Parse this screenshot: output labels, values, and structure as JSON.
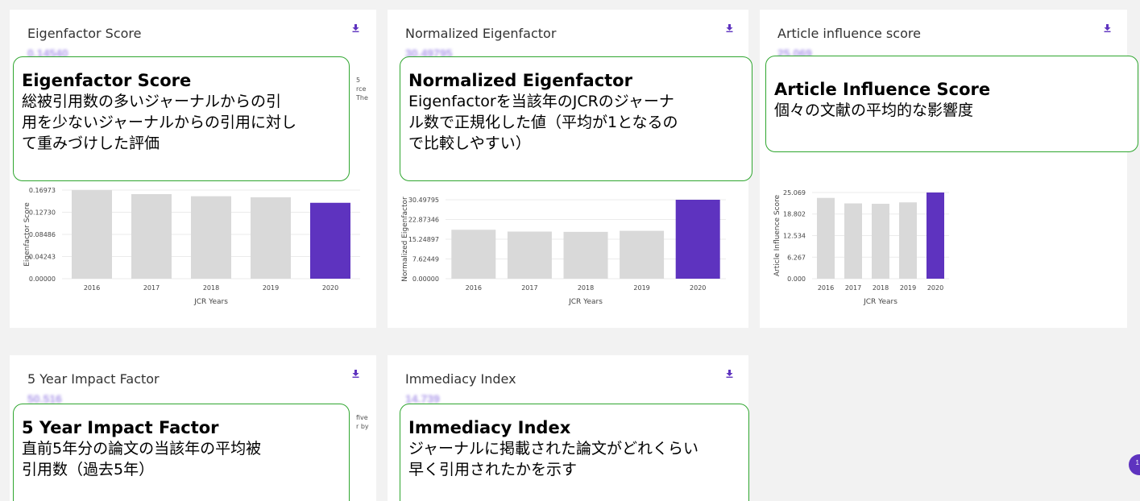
{
  "colors": {
    "bar_gray": "#d9d9d9",
    "bar_highlight": "#5e33bf",
    "callout_border": "#2fa62f",
    "download_icon": "#5e33bf"
  },
  "cards": [
    {
      "title": "Eigenfactor Score",
      "metric_value": "0.14540",
      "peek_text": [
        "5",
        "rce",
        "The"
      ],
      "callout": {
        "heading": "Eigenfactor Score",
        "lines": [
          "総被引用数の多いジャーナルからの引",
          "用を少ないジャーナルからの引用に対し",
          "て重みづけした評価"
        ]
      }
    },
    {
      "title": "Normalized Eigenfactor",
      "metric_value": "30.49795",
      "callout": {
        "heading": "Normalized Eigenfactor",
        "lines": [
          "Eigenfactorを当該年のJCRのジャーナ",
          "ル数で正規化した値（平均が1となるの",
          "で比較しやすい）"
        ]
      }
    },
    {
      "title": "Article influence score",
      "metric_value": "25.069",
      "callout": {
        "heading": "Article Influence Score",
        "lines": [
          "個々の文献の平均的な影響度"
        ]
      }
    },
    {
      "title": "5 Year Impact Factor",
      "metric_value": "50.516",
      "peek_text": [
        "five",
        "r by"
      ],
      "callout": {
        "heading": "5 Year Impact Factor",
        "lines": [
          "直前5年分の論文の当該年の平均被",
          "引用数（過去5年）"
        ]
      }
    },
    {
      "title": "Immediacy Index",
      "metric_value": "14.739",
      "callout": {
        "heading": "Immediacy Index",
        "lines": [
          "ジャーナルに掲載された論文がどれくらい",
          "早く引用されたかを示す"
        ]
      }
    }
  ],
  "badge_text": "1",
  "chart_data": [
    {
      "type": "bar",
      "categories": [
        "2016",
        "2017",
        "2018",
        "2019",
        "2020"
      ],
      "values": [
        0.1697,
        0.162,
        0.158,
        0.156,
        0.1454
      ],
      "ylabel": "Eigenfactor Score",
      "xlabel": "JCR Years",
      "yticks": [
        "0.00000",
        "0.04243",
        "0.08486",
        "0.12730",
        "0.16973"
      ],
      "ylim": [
        0,
        0.16973
      ],
      "highlight_index": 4
    },
    {
      "type": "bar",
      "categories": [
        "2016",
        "2017",
        "2018",
        "2019",
        "2020"
      ],
      "values": [
        18.9,
        18.2,
        18.1,
        18.5,
        30.49795
      ],
      "ylabel": "Normalized Eigenfactor",
      "xlabel": "JCR Years",
      "yticks": [
        "0.00000",
        "7.62449",
        "15.24897",
        "22.87346",
        "30.49795"
      ],
      "ylim": [
        0,
        30.49795
      ],
      "highlight_index": 4
    },
    {
      "type": "bar",
      "categories": [
        "2016",
        "2017",
        "2018",
        "2019",
        "2020"
      ],
      "values": [
        23.5,
        21.9,
        21.8,
        22.2,
        25.069
      ],
      "ylabel": "Article Influence Score",
      "xlabel": "JCR Years",
      "yticks": [
        "0.000",
        "6.267",
        "12.534",
        "18.802",
        "25.069"
      ],
      "ylim": [
        0,
        25.069
      ],
      "highlight_index": 4
    }
  ]
}
